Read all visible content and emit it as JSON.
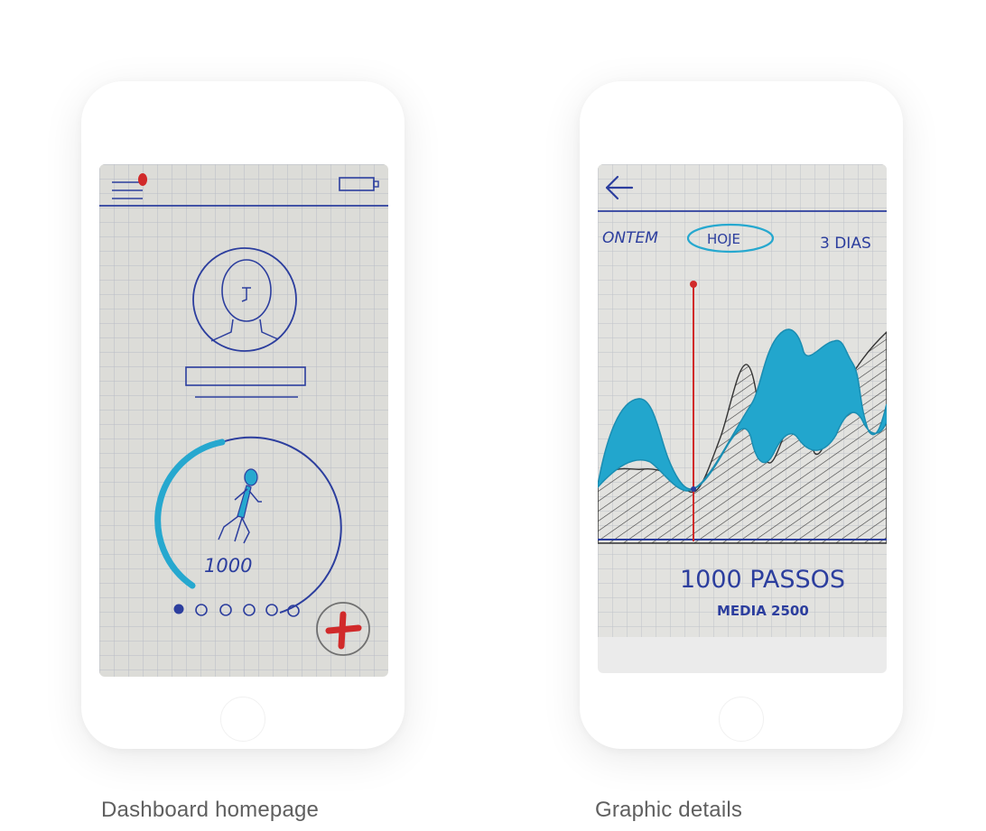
{
  "colors": {
    "paper": "#dcdcd8",
    "grid": "#b9bcc6",
    "ink": "#2c3e9e",
    "accent": "#26a8cf",
    "red": "#d12a2a"
  },
  "dashboard": {
    "caption": "Dashboard homepage",
    "step_count": "1000",
    "page_dots_total": 6,
    "page_dots_active": 1,
    "icons": [
      "menu-icon",
      "notification-dot-icon",
      "battery-icon",
      "avatar-icon",
      "runner-icon",
      "add-icon"
    ]
  },
  "graphic": {
    "caption": "Graphic details",
    "tabs": [
      "ONTEM",
      "HOJE",
      "3 DIAS"
    ],
    "selected_tab": "HOJE",
    "steps_label": "1000 PASSOS",
    "average_label": "MEDIA 2500",
    "icons": [
      "back-arrow-icon"
    ]
  }
}
